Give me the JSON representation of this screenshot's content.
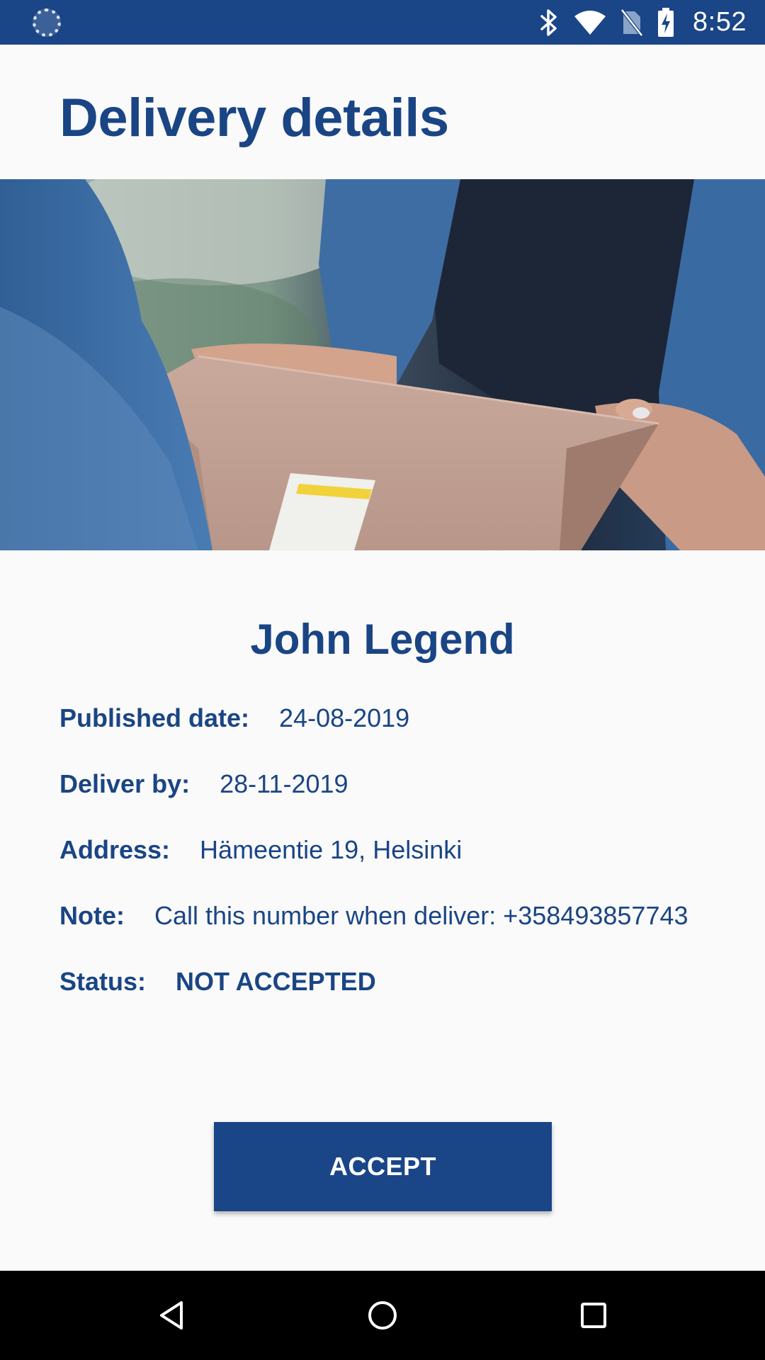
{
  "status_bar": {
    "time": "8:52",
    "icons": [
      "loading-icon",
      "bluetooth-icon",
      "wifi-icon",
      "no-sim-icon",
      "battery-charging-icon"
    ]
  },
  "header": {
    "title": "Delivery details"
  },
  "delivery": {
    "recipient": "John Legend",
    "published_label": "Published date:",
    "published_value": "24-08-2019",
    "deliver_by_label": "Deliver by:",
    "deliver_by_value": "28-11-2019",
    "address_label": "Address:",
    "address_value": "Hämeentie 19, Helsinki",
    "note_label": "Note:",
    "note_value": "Call this number when deliver: +358493857743",
    "status_label": "Status:",
    "status_value": "NOT ACCEPTED"
  },
  "actions": {
    "accept_label": "ACCEPT"
  },
  "nav_bar": {
    "icons": [
      "back-icon",
      "home-icon",
      "recents-icon"
    ]
  },
  "colors": {
    "primary": "#1a4587",
    "background": "#fafafa",
    "text": "#1a4585"
  }
}
